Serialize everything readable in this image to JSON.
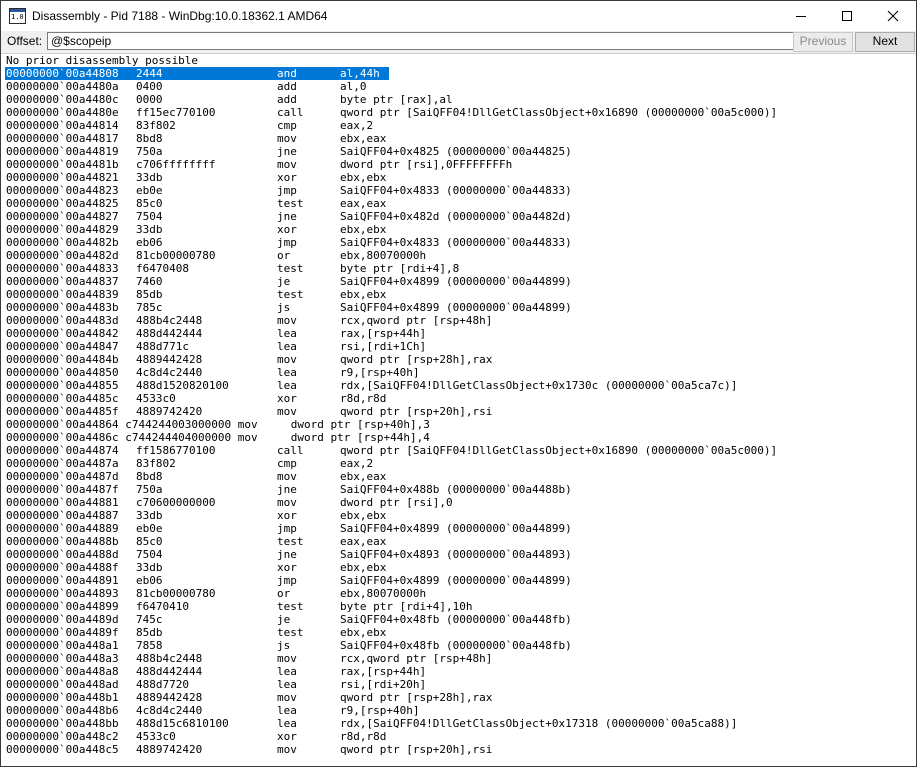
{
  "window": {
    "title": "Disassembly - Pid 7188 - WinDbg:10.0.18362.1 AMD64",
    "icon_text": "1.0"
  },
  "toolbar": {
    "offset_label": "Offset:",
    "offset_value": "@$scopeip",
    "previous_label": "Previous",
    "next_label": "Next"
  },
  "disassembly": {
    "header": "No prior disassembly possible",
    "highlight_index": 0,
    "lines": [
      {
        "addr": "00000000`00a44808",
        "bytes": "2444",
        "mnemonic": "and",
        "operands": "al,44h"
      },
      {
        "addr": "00000000`00a4480a",
        "bytes": "0400",
        "mnemonic": "add",
        "operands": "al,0"
      },
      {
        "addr": "00000000`00a4480c",
        "bytes": "0000",
        "mnemonic": "add",
        "operands": "byte ptr [rax],al"
      },
      {
        "addr": "00000000`00a4480e",
        "bytes": "ff15ec770100",
        "mnemonic": "call",
        "operands": "qword ptr [SaiQFF04!DllGetClassObject+0x16890 (00000000`00a5c000)]"
      },
      {
        "addr": "00000000`00a44814",
        "bytes": "83f802",
        "mnemonic": "cmp",
        "operands": "eax,2"
      },
      {
        "addr": "00000000`00a44817",
        "bytes": "8bd8",
        "mnemonic": "mov",
        "operands": "ebx,eax"
      },
      {
        "addr": "00000000`00a44819",
        "bytes": "750a",
        "mnemonic": "jne",
        "operands": "SaiQFF04+0x4825 (00000000`00a44825)"
      },
      {
        "addr": "00000000`00a4481b",
        "bytes": "c706ffffffff",
        "mnemonic": "mov",
        "operands": "dword ptr [rsi],0FFFFFFFFh"
      },
      {
        "addr": "00000000`00a44821",
        "bytes": "33db",
        "mnemonic": "xor",
        "operands": "ebx,ebx"
      },
      {
        "addr": "00000000`00a44823",
        "bytes": "eb0e",
        "mnemonic": "jmp",
        "operands": "SaiQFF04+0x4833 (00000000`00a44833)"
      },
      {
        "addr": "00000000`00a44825",
        "bytes": "85c0",
        "mnemonic": "test",
        "operands": "eax,eax"
      },
      {
        "addr": "00000000`00a44827",
        "bytes": "7504",
        "mnemonic": "jne",
        "operands": "SaiQFF04+0x482d (00000000`00a4482d)"
      },
      {
        "addr": "00000000`00a44829",
        "bytes": "33db",
        "mnemonic": "xor",
        "operands": "ebx,ebx"
      },
      {
        "addr": "00000000`00a4482b",
        "bytes": "eb06",
        "mnemonic": "jmp",
        "operands": "SaiQFF04+0x4833 (00000000`00a44833)"
      },
      {
        "addr": "00000000`00a4482d",
        "bytes": "81cb00000780",
        "mnemonic": "or",
        "operands": "ebx,80070000h"
      },
      {
        "addr": "00000000`00a44833",
        "bytes": "f6470408",
        "mnemonic": "test",
        "operands": "byte ptr [rdi+4],8"
      },
      {
        "addr": "00000000`00a44837",
        "bytes": "7460",
        "mnemonic": "je",
        "operands": "SaiQFF04+0x4899 (00000000`00a44899)"
      },
      {
        "addr": "00000000`00a44839",
        "bytes": "85db",
        "mnemonic": "test",
        "operands": "ebx,ebx"
      },
      {
        "addr": "00000000`00a4483b",
        "bytes": "785c",
        "mnemonic": "js",
        "operands": "SaiQFF04+0x4899 (00000000`00a44899)"
      },
      {
        "addr": "00000000`00a4483d",
        "bytes": "488b4c2448",
        "mnemonic": "mov",
        "operands": "rcx,qword ptr [rsp+48h]"
      },
      {
        "addr": "00000000`00a44842",
        "bytes": "488d442444",
        "mnemonic": "lea",
        "operands": "rax,[rsp+44h]"
      },
      {
        "addr": "00000000`00a44847",
        "bytes": "488d771c",
        "mnemonic": "lea",
        "operands": "rsi,[rdi+1Ch]"
      },
      {
        "addr": "00000000`00a4484b",
        "bytes": "4889442428",
        "mnemonic": "mov",
        "operands": "qword ptr [rsp+28h],rax"
      },
      {
        "addr": "00000000`00a44850",
        "bytes": "4c8d4c2440",
        "mnemonic": "lea",
        "operands": "r9,[rsp+40h]"
      },
      {
        "addr": "00000000`00a44855",
        "bytes": "488d1520820100",
        "mnemonic": "lea",
        "operands": "rdx,[SaiQFF04!DllGetClassObject+0x1730c (00000000`00a5ca7c)]"
      },
      {
        "addr": "00000000`00a4485c",
        "bytes": "4533c0",
        "mnemonic": "xor",
        "operands": "r8d,r8d"
      },
      {
        "addr": "00000000`00a4485f",
        "bytes": "4889742420",
        "mnemonic": "mov",
        "operands": "qword ptr [rsp+20h],rsi"
      },
      {
        "text": "00000000`00a44864 c744244003000000 mov     dword ptr [rsp+40h],3"
      },
      {
        "text": "00000000`00a4486c c744244404000000 mov     dword ptr [rsp+44h],4"
      },
      {
        "addr": "00000000`00a44874",
        "bytes": "ff1586770100",
        "mnemonic": "call",
        "operands": "qword ptr [SaiQFF04!DllGetClassObject+0x16890 (00000000`00a5c000)]"
      },
      {
        "addr": "00000000`00a4487a",
        "bytes": "83f802",
        "mnemonic": "cmp",
        "operands": "eax,2"
      },
      {
        "addr": "00000000`00a4487d",
        "bytes": "8bd8",
        "mnemonic": "mov",
        "operands": "ebx,eax"
      },
      {
        "addr": "00000000`00a4487f",
        "bytes": "750a",
        "mnemonic": "jne",
        "operands": "SaiQFF04+0x488b (00000000`00a4488b)"
      },
      {
        "addr": "00000000`00a44881",
        "bytes": "c70600000000",
        "mnemonic": "mov",
        "operands": "dword ptr [rsi],0"
      },
      {
        "addr": "00000000`00a44887",
        "bytes": "33db",
        "mnemonic": "xor",
        "operands": "ebx,ebx"
      },
      {
        "addr": "00000000`00a44889",
        "bytes": "eb0e",
        "mnemonic": "jmp",
        "operands": "SaiQFF04+0x4899 (00000000`00a44899)"
      },
      {
        "addr": "00000000`00a4488b",
        "bytes": "85c0",
        "mnemonic": "test",
        "operands": "eax,eax"
      },
      {
        "addr": "00000000`00a4488d",
        "bytes": "7504",
        "mnemonic": "jne",
        "operands": "SaiQFF04+0x4893 (00000000`00a44893)"
      },
      {
        "addr": "00000000`00a4488f",
        "bytes": "33db",
        "mnemonic": "xor",
        "operands": "ebx,ebx"
      },
      {
        "addr": "00000000`00a44891",
        "bytes": "eb06",
        "mnemonic": "jmp",
        "operands": "SaiQFF04+0x4899 (00000000`00a44899)"
      },
      {
        "addr": "00000000`00a44893",
        "bytes": "81cb00000780",
        "mnemonic": "or",
        "operands": "ebx,80070000h"
      },
      {
        "addr": "00000000`00a44899",
        "bytes": "f6470410",
        "mnemonic": "test",
        "operands": "byte ptr [rdi+4],10h"
      },
      {
        "addr": "00000000`00a4489d",
        "bytes": "745c",
        "mnemonic": "je",
        "operands": "SaiQFF04+0x48fb (00000000`00a448fb)"
      },
      {
        "addr": "00000000`00a4489f",
        "bytes": "85db",
        "mnemonic": "test",
        "operands": "ebx,ebx"
      },
      {
        "addr": "00000000`00a448a1",
        "bytes": "7858",
        "mnemonic": "js",
        "operands": "SaiQFF04+0x48fb (00000000`00a448fb)"
      },
      {
        "addr": "00000000`00a448a3",
        "bytes": "488b4c2448",
        "mnemonic": "mov",
        "operands": "rcx,qword ptr [rsp+48h]"
      },
      {
        "addr": "00000000`00a448a8",
        "bytes": "488d442444",
        "mnemonic": "lea",
        "operands": "rax,[rsp+44h]"
      },
      {
        "addr": "00000000`00a448ad",
        "bytes": "488d7720",
        "mnemonic": "lea",
        "operands": "rsi,[rdi+20h]"
      },
      {
        "addr": "00000000`00a448b1",
        "bytes": "4889442428",
        "mnemonic": "mov",
        "operands": "qword ptr [rsp+28h],rax"
      },
      {
        "addr": "00000000`00a448b6",
        "bytes": "4c8d4c2440",
        "mnemonic": "lea",
        "operands": "r9,[rsp+40h]"
      },
      {
        "addr": "00000000`00a448bb",
        "bytes": "488d15c6810100",
        "mnemonic": "lea",
        "operands": "rdx,[SaiQFF04!DllGetClassObject+0x17318 (00000000`00a5ca88)]"
      },
      {
        "addr": "00000000`00a448c2",
        "bytes": "4533c0",
        "mnemonic": "xor",
        "operands": "r8d,r8d"
      },
      {
        "addr": "00000000`00a448c5",
        "bytes": "4889742420",
        "mnemonic": "mov",
        "operands": "qword ptr [rsp+20h],rsi"
      }
    ]
  }
}
